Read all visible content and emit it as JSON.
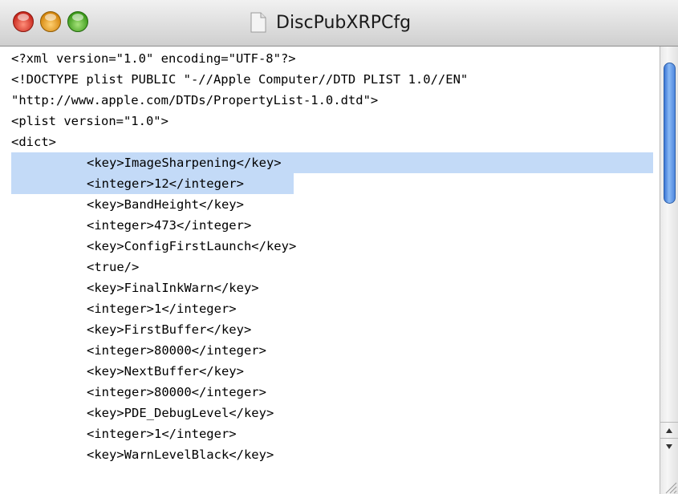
{
  "window": {
    "title": "DiscPubXRPCfg"
  },
  "editor": {
    "lines": [
      "<?xml version=\"1.0\" encoding=\"UTF-8\"?>",
      "<!DOCTYPE plist PUBLIC \"-//Apple Computer//DTD PLIST 1.0//EN\"",
      "\"http://www.apple.com/DTDs/PropertyList-1.0.dtd\">",
      "<plist version=\"1.0\">",
      "<dict>",
      "\t<key>ImageSharpening</key>",
      "\t<integer>12</integer>",
      "\t<key>BandHeight</key>",
      "\t<integer>473</integer>",
      "\t<key>ConfigFirstLaunch</key>",
      "\t<true/>",
      "\t<key>FinalInkWarn</key>",
      "\t<integer>1</integer>",
      "\t<key>FirstBuffer</key>",
      "\t<integer>80000</integer>",
      "\t<key>NextBuffer</key>",
      "\t<integer>80000</integer>",
      "\t<key>PDE_DebugLevel</key>",
      "\t<integer>1</integer>",
      "\t<key>WarnLevelBlack</key>"
    ],
    "selected_lines": [
      5,
      6
    ]
  },
  "colors": {
    "selection": "#c3daf7",
    "scroll_thumb": "#3b76d6"
  },
  "icons": {
    "document": "document-icon",
    "scroll_up": "scroll-up-arrow-icon",
    "scroll_down": "scroll-down-arrow-icon",
    "resize": "resize-grip-icon"
  }
}
